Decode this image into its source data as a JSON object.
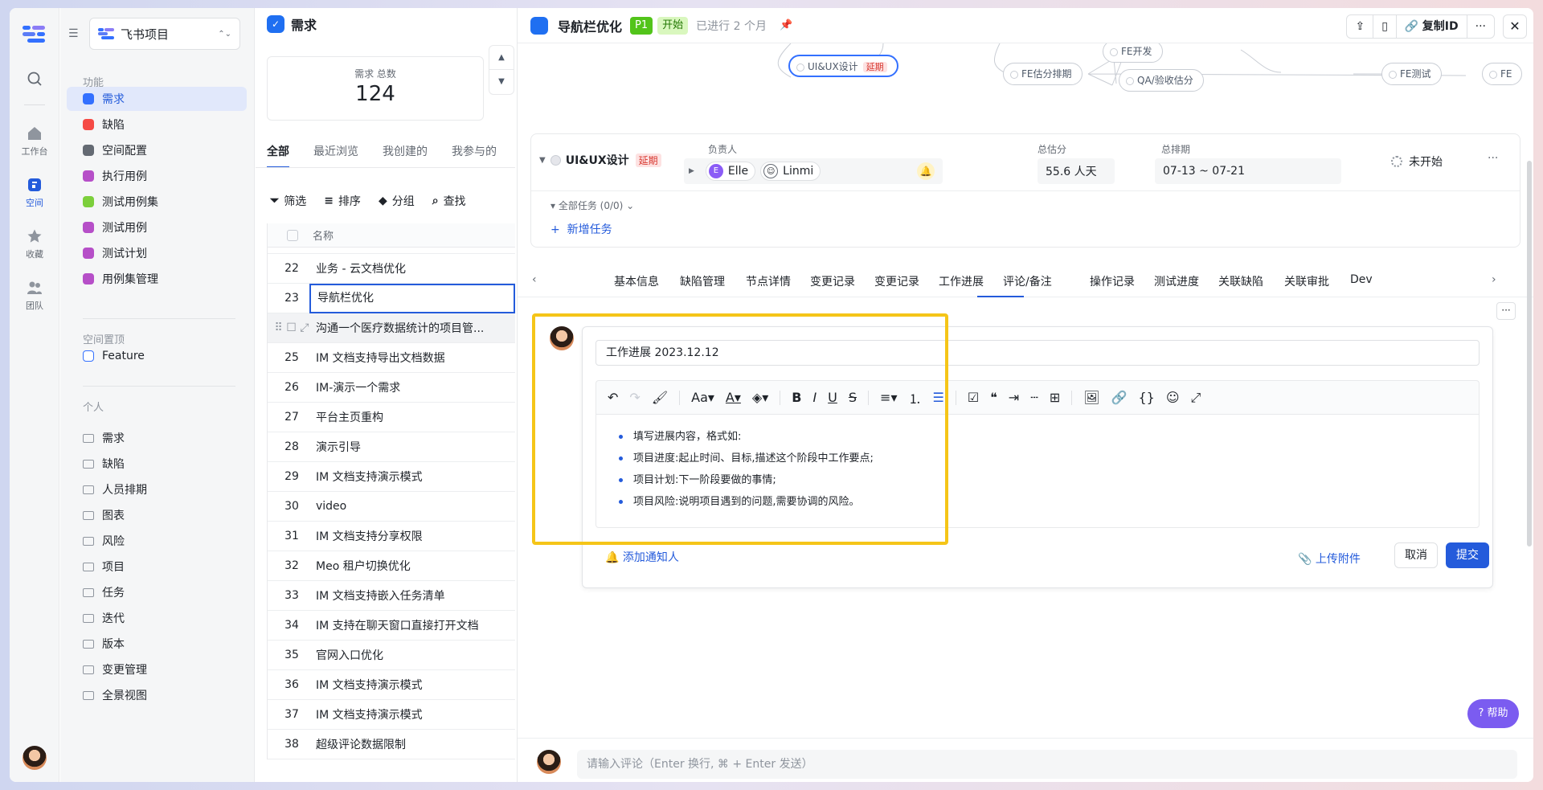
{
  "rail": {
    "items": [
      {
        "label": "工作台"
      },
      {
        "label": "空间"
      },
      {
        "label": "收藏"
      },
      {
        "label": "团队"
      }
    ]
  },
  "sidebar": {
    "project": "飞书项目",
    "section_func": "功能",
    "func_items": [
      {
        "label": "需求",
        "color": "#3370ff"
      },
      {
        "label": "缺陷",
        "color": "#f54a45"
      },
      {
        "label": "空间配置",
        "color": "#646a73"
      },
      {
        "label": "执行用例",
        "color": "#b64fc8"
      },
      {
        "label": "测试用例集",
        "color": "#7ccf3c"
      },
      {
        "label": "测试用例",
        "color": "#b64fc8"
      },
      {
        "label": "测试计划",
        "color": "#b64fc8"
      },
      {
        "label": "用例集管理",
        "color": "#b64fc8"
      }
    ],
    "section_pinned": "空间置顶",
    "pinned_items": [
      {
        "label": "Feature"
      }
    ],
    "section_personal": "个人",
    "personal_items": [
      {
        "label": "需求"
      },
      {
        "label": "缺陷"
      },
      {
        "label": "人员排期"
      },
      {
        "label": "图表"
      },
      {
        "label": "风险"
      },
      {
        "label": "项目"
      },
      {
        "label": "任务"
      },
      {
        "label": "迭代"
      },
      {
        "label": "版本"
      },
      {
        "label": "变更管理"
      },
      {
        "label": "全景视图"
      }
    ]
  },
  "list": {
    "title": "需求",
    "stat_label": "需求 总数",
    "stat_value": "124",
    "tabs": [
      "全部",
      "最近浏览",
      "我创建的",
      "我参与的"
    ],
    "tools": [
      "筛选",
      "排序",
      "分组",
      "查找"
    ],
    "col_name": "名称",
    "rows": [
      {
        "n": "22",
        "name": "业务 - 云文档优化"
      },
      {
        "n": "23",
        "name": "导航栏优化"
      },
      {
        "n": "",
        "name": "沟通一个医疗数据统计的项目管..."
      },
      {
        "n": "25",
        "name": "IM 文档支持导出文档数据"
      },
      {
        "n": "26",
        "name": "IM-演示一个需求"
      },
      {
        "n": "27",
        "name": "平台主页重构"
      },
      {
        "n": "28",
        "name": "演示引导"
      },
      {
        "n": "29",
        "name": "IM 文档支持演示模式"
      },
      {
        "n": "30",
        "name": "video"
      },
      {
        "n": "31",
        "name": "IM 文档支持分享权限"
      },
      {
        "n": "32",
        "name": "Meo 租户切换优化"
      },
      {
        "n": "33",
        "name": "IM 文档支持嵌入任务清单"
      },
      {
        "n": "34",
        "name": "IM 支持在聊天窗口直接打开文档"
      },
      {
        "n": "35",
        "name": "官网入口优化"
      },
      {
        "n": "36",
        "name": "IM 文档支持演示模式"
      },
      {
        "n": "37",
        "name": "IM 文档支持演示模式"
      },
      {
        "n": "38",
        "name": "超级评论数据限制"
      }
    ]
  },
  "detail": {
    "title": "导航栏优化",
    "priority": "P1",
    "status": "开始",
    "duration": "已进行 2 个月",
    "copy_id": "复制ID",
    "flow": {
      "active": "UI&UX设计",
      "late": "延期",
      "nodes": [
        "FE开发",
        "FE估分排期",
        "QA/验收估分",
        "FE测试",
        "FE"
      ]
    },
    "node_card": {
      "name": "UI&UX设计",
      "late": "延期",
      "owner_label": "负责人",
      "owners": [
        "Elle",
        "Linmi"
      ],
      "estimate_label": "总估分",
      "estimate": "55.6 人天",
      "schedule_label": "总排期",
      "schedule": "07-13 ~ 07-21",
      "state": "未开始",
      "subtasks": "全部任务 (0/0)",
      "add_task": "新增任务"
    },
    "tabs": [
      "基本信息",
      "缺陷管理",
      "节点详情",
      "变更记录",
      "变更记录",
      "工作进展",
      "评论/备注",
      "操作记录",
      "测试进度",
      "关联缺陷",
      "关联审批",
      "Dev"
    ],
    "active_tab": "工作进展",
    "editor": {
      "title_value": "工作进展 2023.12.12",
      "bullets": [
        "填写进展内容，格式如:",
        "项目进度:起止时间、目标,描述这个阶段中工作要点;",
        "项目计划:下一阶段要做的事情;",
        "项目风险:说明项目遇到的问题,需要协调的风险。"
      ],
      "notify": "添加通知人",
      "upload": "上传附件",
      "cancel": "取消",
      "submit": "提交"
    },
    "comment_placeholder": "请输入评论（Enter 换行, ⌘ + Enter 发送）",
    "help": "帮助"
  }
}
